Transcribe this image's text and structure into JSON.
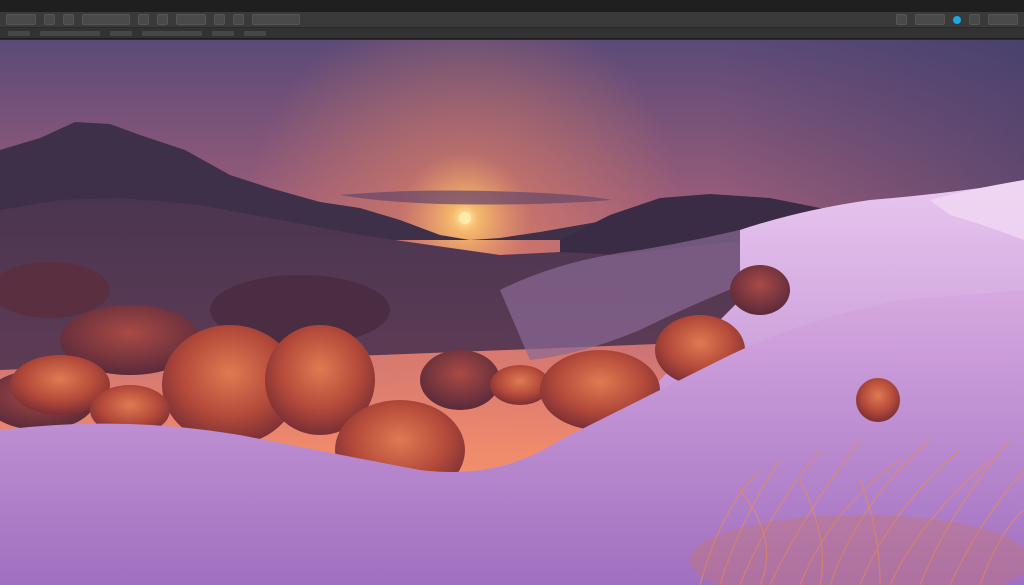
{
  "menubar": {},
  "toolbar": {
    "accent_color": "#1ea7e8"
  },
  "photo": {
    "sky_top": "#5b4a78",
    "sky_horizon": "#f08a6c",
    "sun_color": "#ffd27a",
    "snow_color": "#c59ad6",
    "shrub_color": "#c7533b",
    "mountain_color": "#3e3048"
  }
}
